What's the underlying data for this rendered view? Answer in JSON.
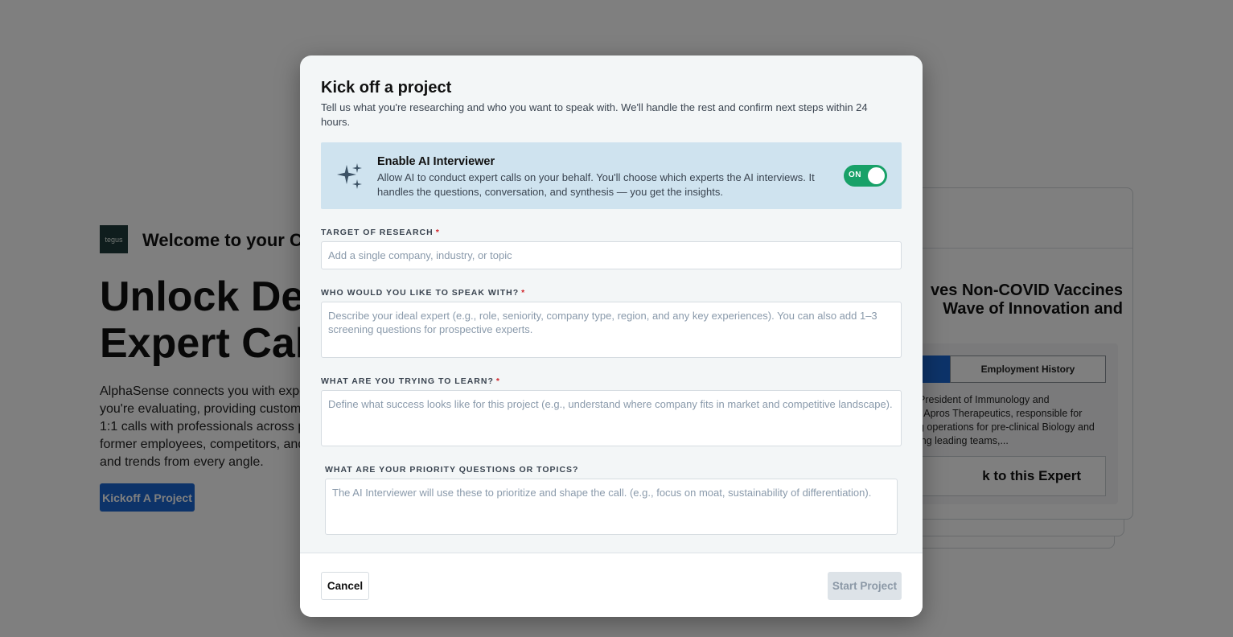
{
  "background": {
    "logo_text": "tegus",
    "welcome": "Welcome to your Ca",
    "headline_line1": "Unlock Dec",
    "headline_line2": "Expert Call",
    "description": "AlphaSense connects you with exper\nyou're evaluating, providing custom-s\n1:1 calls with professionals across p\nformer employees, competitors, and\nand trends from every angle.",
    "kickoff_button": "Kickoff A Project",
    "card": {
      "title": "ves Non-COVID Vaccines\nWave of Innovation and",
      "tab_employment": "Employment History",
      "body": "President of Immunology and\nt Apros Therapeutics, responsible for\ng operations for pre-clinical Biology and\ning leading teams,...",
      "talk_button": "k to this Expert"
    }
  },
  "modal": {
    "title": "Kick off a project",
    "subtitle": "Tell us what you're researching and who you want to speak with. We'll handle the rest and confirm next steps within 24 hours.",
    "ai_interviewer": {
      "icon": "sparkles-icon",
      "title": "Enable AI Interviewer",
      "description": "Allow AI to conduct expert calls on your behalf. You'll choose which experts the AI interviews. It handles the questions, conversation, and synthesis — you get the insights.",
      "toggle_label": "ON",
      "enabled": true
    },
    "fields": {
      "target": {
        "label": "TARGET OF RESEARCH",
        "required": "*",
        "placeholder": "Add a single company, industry, or topic",
        "value": ""
      },
      "speak_with": {
        "label": "WHO WOULD YOU LIKE TO SPEAK WITH?",
        "required": "*",
        "placeholder": "Describe your ideal expert (e.g., role, seniority, company type, region, and any key experiences). You can also add 1–3 screening questions for prospective experts.",
        "value": ""
      },
      "learn": {
        "label": "WHAT ARE YOU TRYING TO LEARN?",
        "required": "*",
        "placeholder": "Define what success looks like for this project (e.g., understand where company fits in market and competitive landscape).",
        "value": ""
      },
      "priority": {
        "label": "WHAT ARE YOUR PRIORITY QUESTIONS OR TOPICS?",
        "placeholder": "The AI Interviewer will use these to prioritize and shape the call. (e.g., focus on moat, sustainability of differentiation).",
        "value": ""
      }
    },
    "footer": {
      "cancel_label": "Cancel",
      "start_label": "Start Project"
    }
  },
  "colors": {
    "accent_blue": "#1a66d2",
    "toggle_green": "#18a168",
    "banner_bg": "#cfe3ef",
    "required_red": "#d0262c"
  }
}
